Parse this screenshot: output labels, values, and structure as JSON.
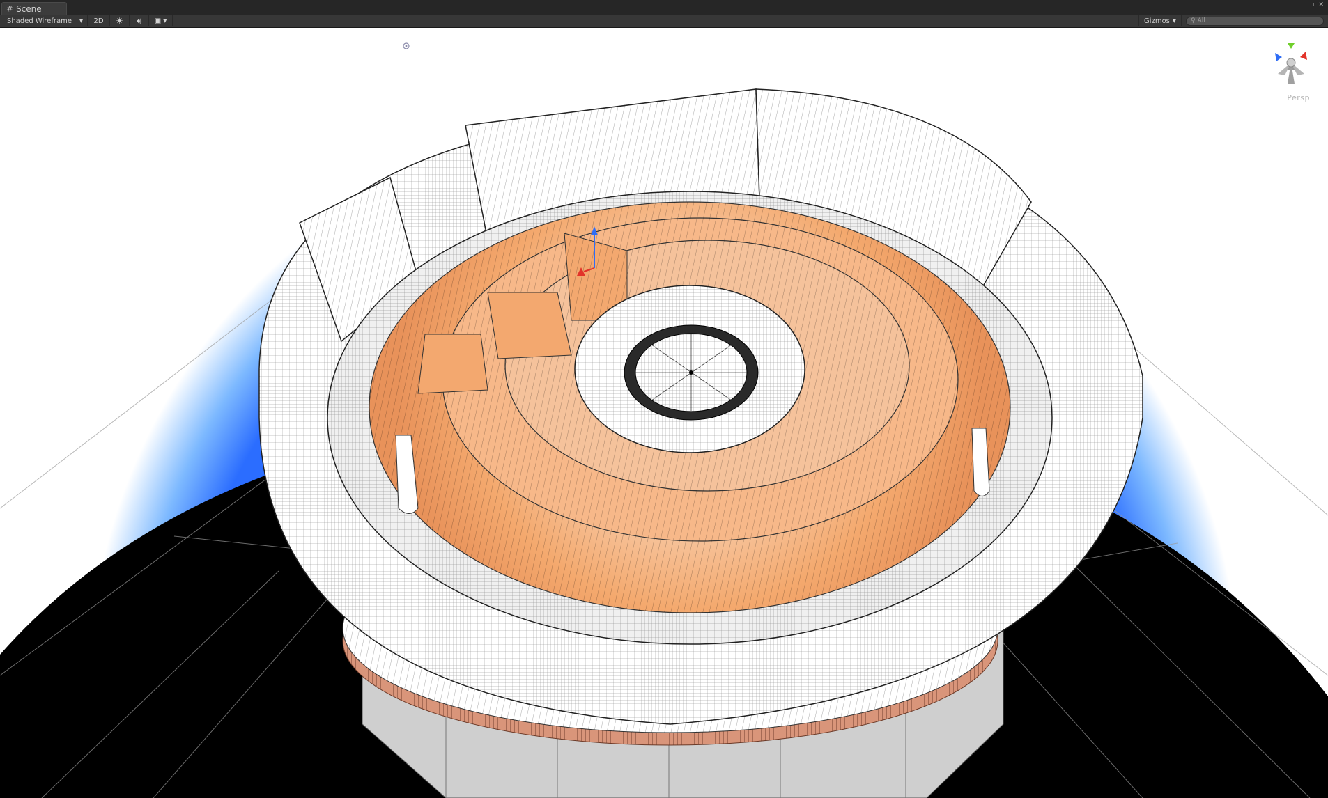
{
  "window": {
    "tab_label": "Scene",
    "tab_icon": "grid-icon"
  },
  "toolbar": {
    "draw_mode": "Shaded Wireframe",
    "mode_2d": "2D",
    "lighting_icon": "sun-icon",
    "audio_icon": "speaker-icon",
    "effects_icon": "image-icon",
    "gizmos_label": "Gizmos",
    "search_placeholder": "All"
  },
  "viewport": {
    "projection_label": "Persp",
    "background": "#ffffff",
    "ground_color": "#000000",
    "sky_gradient": [
      "#ffffff",
      "#cfe8ff",
      "#2a7bff"
    ],
    "accent_wood": "#f6b07a",
    "accent_copper": "#c98566"
  },
  "gizmo": {
    "axis_colors": {
      "x": "#e2342a",
      "y": "#6fcf2b",
      "z": "#2f6df5"
    }
  }
}
